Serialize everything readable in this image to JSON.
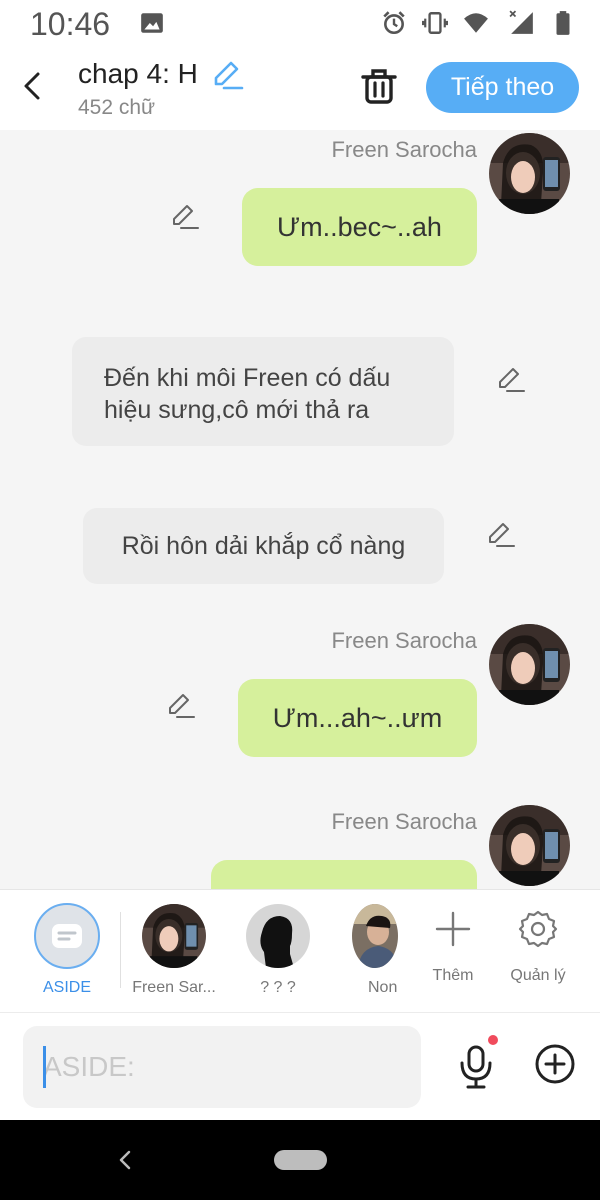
{
  "status_bar": {
    "time": "10:46",
    "icons": [
      "image-icon",
      "alarm-icon",
      "vibrate-icon",
      "wifi-icon",
      "signal-icon",
      "battery-icon"
    ]
  },
  "header": {
    "title": "chap 4: H",
    "word_count": "452 chữ",
    "next_label": "Tiếp theo"
  },
  "chat": {
    "messages": [
      {
        "type": "character",
        "speaker": "Freen Sarocha",
        "text": "Ưm..bec~..ah"
      },
      {
        "type": "aside",
        "text_line1": "Đến khi môi Freen có dấu",
        "text_line2": "hiệu sưng,cô mới thả ra"
      },
      {
        "type": "aside",
        "text": "Rồi hôn dải khắp cổ nàng"
      },
      {
        "type": "character",
        "speaker": "Freen Sarocha",
        "text": "Ưm...ah~..ưm"
      },
      {
        "type": "character",
        "speaker": "Freen Sarocha",
        "text": ""
      }
    ]
  },
  "character_bar": {
    "items": [
      {
        "label": "ASIDE"
      },
      {
        "label": "Freen Sar..."
      },
      {
        "label": "? ? ?"
      },
      {
        "label": "Non"
      },
      {
        "label": "Thêm"
      },
      {
        "label": "Quản lý"
      }
    ]
  },
  "input": {
    "placeholder": "ASIDE:",
    "value": ""
  },
  "colors": {
    "accent": "#57adf5",
    "character_bubble": "#d6f09c",
    "aside_bubble": "#ececec",
    "mic_badge": "#f04b5c",
    "aside_label": "#3b8fe8"
  }
}
